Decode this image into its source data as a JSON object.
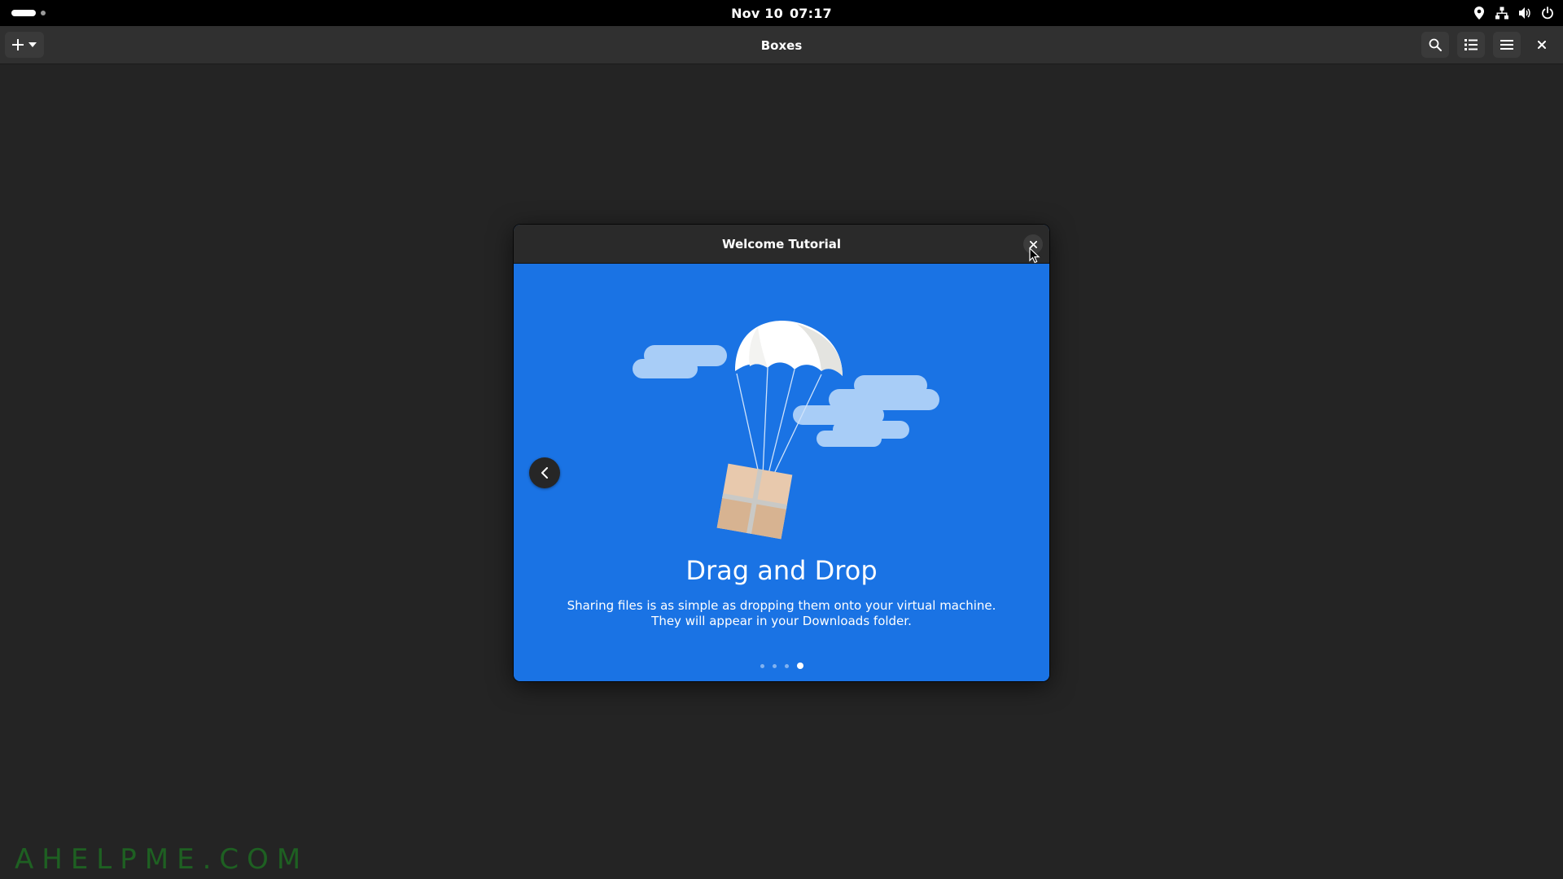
{
  "topbar": {
    "date": "Nov 10",
    "time": "07:17"
  },
  "header": {
    "title": "Boxes"
  },
  "dialog": {
    "title": "Welcome Tutorial",
    "slide": {
      "title": "Drag and Drop",
      "description": "Sharing files is as simple as dropping them onto your virtual machine. They will appear in your Downloads folder."
    },
    "pages": {
      "total": 4,
      "current": 4
    }
  },
  "icons": {
    "activities": "workspace-indicator-icon",
    "location": "location-icon",
    "network": "network-wired-icon",
    "volume": "volume-icon",
    "power": "power-icon",
    "new": "plus-icon",
    "dropdown": "chevron-down-icon",
    "search": "search-icon",
    "view": "list-view-icon",
    "menu": "hamburger-menu-icon",
    "close": "close-icon",
    "back": "chevron-left-icon"
  },
  "colors": {
    "slide_background": "#1a73e4",
    "window_background": "#242424",
    "watermark": "#1e6b22"
  },
  "watermark": "AHELPME.COM"
}
